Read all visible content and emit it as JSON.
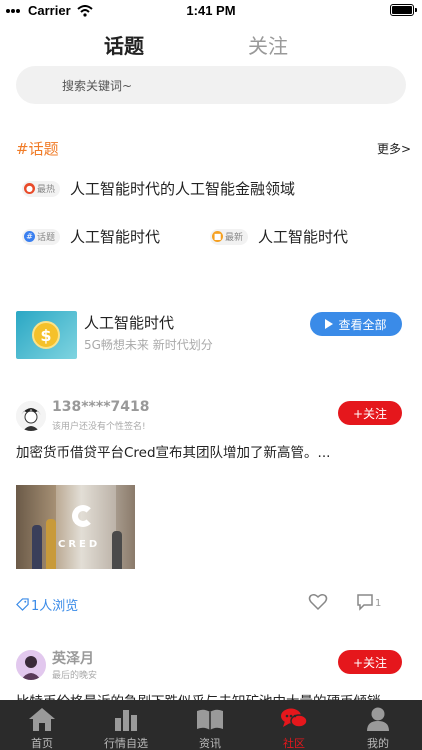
{
  "status": {
    "carrier": "Carrier",
    "time": "1:41 PM"
  },
  "top_tabs": [
    {
      "label": "话题"
    },
    {
      "label": "关注"
    }
  ],
  "search": {
    "placeholder": "搜索关键词~"
  },
  "topics": {
    "title": "#话题",
    "more": "更多>",
    "items": [
      {
        "badge": "最热",
        "text": "人工智能时代的人工智能金融领域",
        "badge_color": "#e94b2a"
      },
      {
        "badge": "话题",
        "text": "人工智能时代",
        "badge_color": "#3a7ff0"
      },
      {
        "badge": "最新",
        "text": "人工智能时代",
        "badge_color": "#f5a021"
      }
    ]
  },
  "feature": {
    "title": "人工智能时代",
    "subtitle": "5G畅想未来 新时代划分",
    "button": "查看全部",
    "coin_symbol": "$"
  },
  "posts": [
    {
      "name": "138****7418",
      "signature": "该用户还没有个性签名!",
      "follow": "+关注",
      "text": "加密货币借贷平台Cred宣布其团队增加了新高管。...",
      "image_text": "CRED",
      "views": "1人浏览",
      "comment_count": "1"
    },
    {
      "name": "英泽月",
      "signature": "最后的晚安",
      "follow": "+关注",
      "text": "比特币价格最近的急剧下跌似乎与未知矿池中大量的硬币倾销"
    }
  ],
  "tabbar": [
    {
      "label": "首页",
      "icon": "home-icon"
    },
    {
      "label": "行情自选",
      "icon": "bar-chart-icon"
    },
    {
      "label": "资讯",
      "icon": "book-icon"
    },
    {
      "label": "社区",
      "icon": "chat-bubbles-icon"
    },
    {
      "label": "我的",
      "icon": "user-icon"
    }
  ],
  "colors": {
    "accent_red": "#e5171c",
    "accent_blue": "#3a8be8",
    "topic_orange": "#f07c28",
    "tabbar_bg": "#2b2b2b"
  }
}
